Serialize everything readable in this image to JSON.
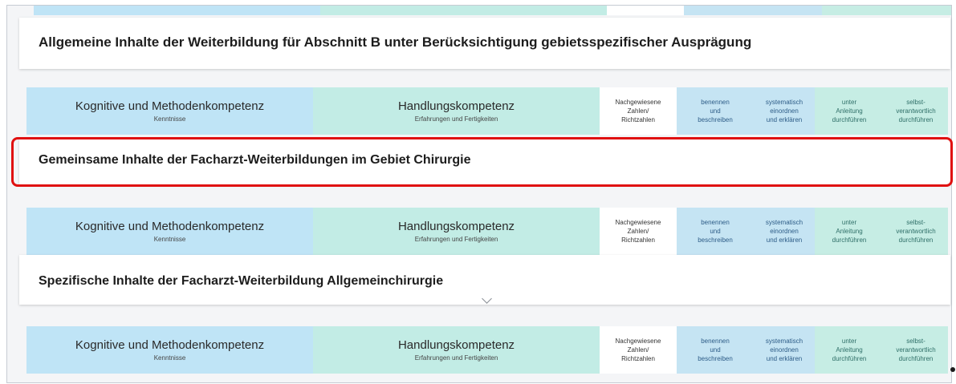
{
  "sections": {
    "allgemein_title": "Allgemeine Inhalte der Weiterbildung für Abschnitt B unter Berücksichtigung gebietsspezifischer Ausprägung",
    "gemeinsam_title": "Gemeinsame Inhalte der Facharzt-Weiterbildungen im Gebiet Chirurgie",
    "spezifisch_title": "Spezifische Inhalte der Facharzt-Weiterbildung Allgemeinchirurgie"
  },
  "header": {
    "kognitiv": "Kognitive und Methodenkompetenz",
    "kognitiv_sub": "Kenntnisse",
    "handlung": "Handlungskompetenz",
    "handlung_sub": "Erfahrungen und Fertigkeiten",
    "nach_1": "Nachgewiesene",
    "nach_2": "Zahlen/",
    "nach_3": "Richtzahlen",
    "ben_1": "benennen",
    "ben_2": "und",
    "ben_3": "beschreiben",
    "sys_1": "systematisch",
    "sys_2": "einordnen",
    "sys_3": "und erklären",
    "unt_1": "unter",
    "unt_2": "Anleitung",
    "unt_3": "durchführen",
    "sel_1": "selbst-",
    "sel_2": "verantwortlich",
    "sel_3": "durchführen"
  },
  "colors": {
    "kognitiv_bg": "#bfe4f6",
    "handlung_bg": "#c2ece5",
    "highlight_border": "#e01010"
  },
  "icons": {
    "collapse": "chevron-down-icon"
  }
}
